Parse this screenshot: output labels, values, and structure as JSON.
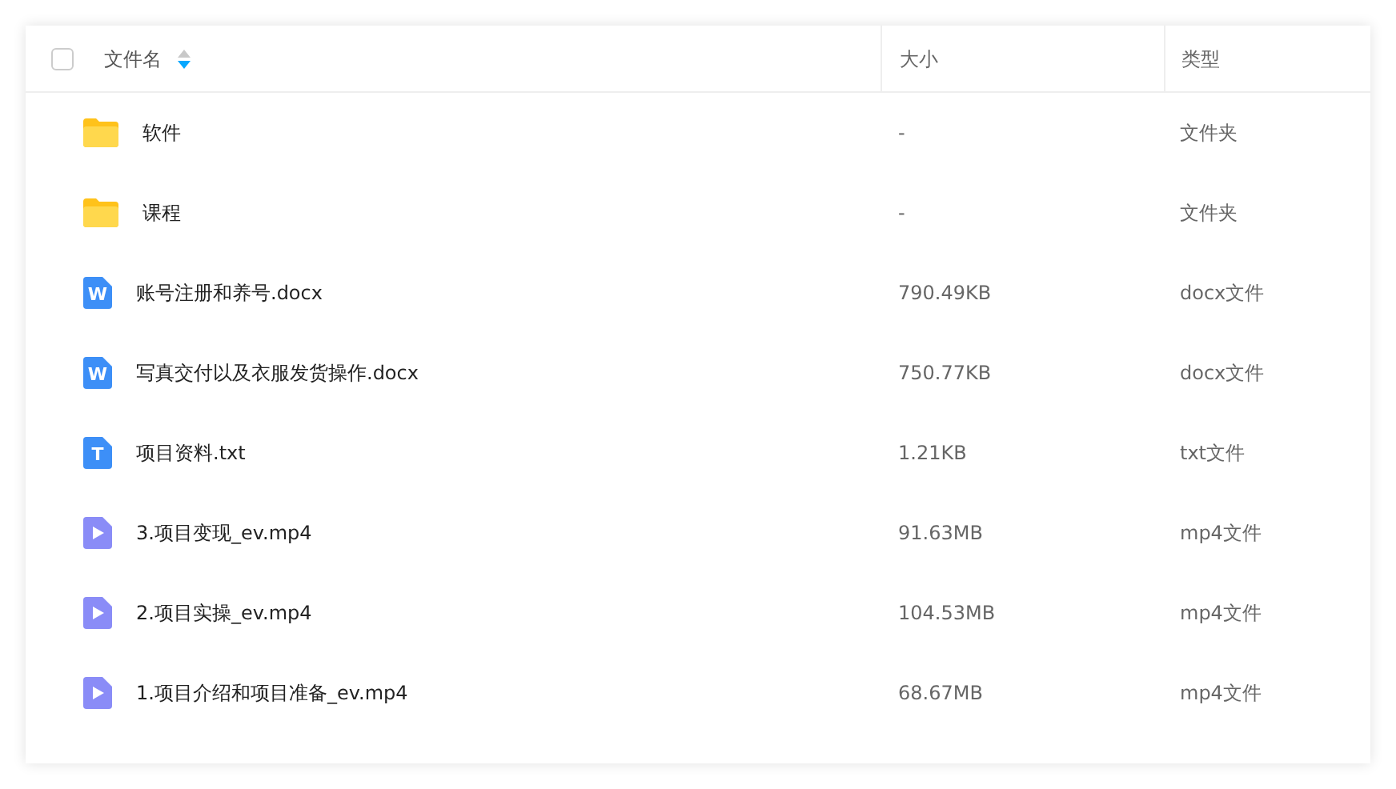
{
  "table": {
    "select_all": {
      "checked": false
    },
    "columns": [
      {
        "label": "文件名",
        "sort_descending": true
      },
      {
        "label": "大小"
      },
      {
        "label": "类型"
      }
    ],
    "rows": [
      {
        "kind": "folder",
        "name": "软件",
        "size": "-",
        "type": "文件夹"
      },
      {
        "kind": "folder",
        "name": "课程",
        "size": "-",
        "type": "文件夹"
      },
      {
        "kind": "doc",
        "glyph": "W",
        "name": "账号注册和养号.docx",
        "size": "790.49KB",
        "type": "docx文件"
      },
      {
        "kind": "doc",
        "glyph": "W",
        "name": "写真交付以及衣服发货操作.docx",
        "size": "750.77KB",
        "type": "docx文件"
      },
      {
        "kind": "doc",
        "glyph": "T",
        "name": "项目资料.txt",
        "size": "1.21KB",
        "type": "txt文件"
      },
      {
        "kind": "video",
        "name": "3.项目变现_ev.mp4",
        "size": "91.63MB",
        "type": "mp4文件"
      },
      {
        "kind": "video",
        "name": "2.项目实操_ev.mp4",
        "size": "104.53MB",
        "type": "mp4文件"
      },
      {
        "kind": "video",
        "name": "1.项目介绍和项目准备_ev.mp4",
        "size": "68.67MB",
        "type": "mp4文件"
      }
    ]
  }
}
